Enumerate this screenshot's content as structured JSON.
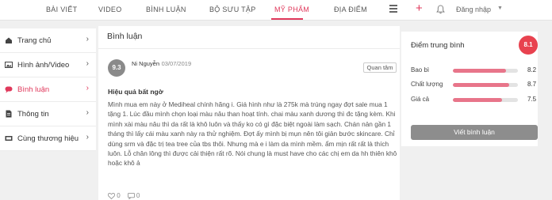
{
  "nav": {
    "tabs": [
      {
        "label": "BÀI VIẾT"
      },
      {
        "label": "VIDEO"
      },
      {
        "label": "BÌNH LUẬN"
      },
      {
        "label": "BỘ SƯU TẬP"
      },
      {
        "label": "MỸ PHẨM",
        "active": true
      },
      {
        "label": "ĐỊA ĐIỂM"
      }
    ],
    "login_label": "Đăng nhập"
  },
  "sidebar": {
    "items": [
      {
        "label": "Trang chủ",
        "icon": "home-icon"
      },
      {
        "label": "Hình ảnh/Video",
        "icon": "image-icon"
      },
      {
        "label": "Bình luận",
        "icon": "comment-icon",
        "active": true
      },
      {
        "label": "Thông tin",
        "icon": "document-icon"
      },
      {
        "label": "Cùng thương hiệu",
        "icon": "brand-icon"
      }
    ]
  },
  "main": {
    "title": "Bình luận",
    "review": {
      "user_score": "9.3",
      "username": "Ni Nguyễn",
      "date": "- 03/07/2019",
      "follow_label": "Quan tâm",
      "title": "Hiệu quả bất ngờ",
      "body": "Mình mua em này ở Mediheal chính hãng i. Giá hình như là 275k mà trúng ngay đợt sale mua 1 tặng 1. Lúc đầu mình chọn loại màu nâu than hoạt tính. chai màu xanh dương thì đc tặng kèm. Khi mình xài màu nâu thì da rất là khô luôn và thấy ko có gì đặc biệt ngoài làm sạch. Chán nản gần 1 tháng thì lấy cái màu xanh này ra thử nghiệm. Đợt ấy mình bị mụn nên tôi giản bước skincare. Chỉ dùng srm và đặc trị tea tree của tbs thôi. Nhưng mà e i làm da mình mềm. ẩm mịn rất rất là thích luôn. Lỗ chân lông thì được cải thiện rất rõ. Nói chung là must have cho các chị em da hh thiên khô hoặc khô ả",
      "likes": "0",
      "comments": "0"
    }
  },
  "rating": {
    "title": "Điểm trung bình",
    "average": "8.1",
    "criteria": [
      {
        "label": "Bao bì",
        "value": "8.2",
        "fraction": 0.82
      },
      {
        "label": "Chất lượng",
        "value": "8.7",
        "fraction": 0.87
      },
      {
        "label": "Giá cả",
        "value": "7.5",
        "fraction": 0.75
      }
    ],
    "button_label": "Viết bình luận"
  },
  "colors": {
    "accent": "#e0385b",
    "bar_fill": "#e8758a",
    "badge": "#e8424f",
    "button": "#8d8d8d"
  }
}
